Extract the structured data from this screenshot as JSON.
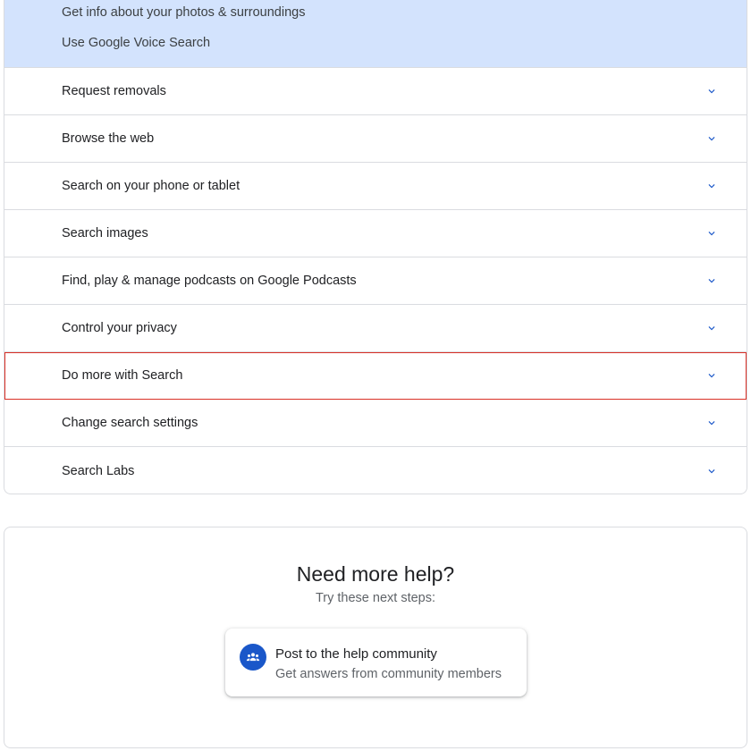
{
  "expanded_section": {
    "links": [
      "Get info about your photos & surroundings",
      "Use Google Voice Search"
    ]
  },
  "topics": [
    {
      "label": "Request removals"
    },
    {
      "label": "Browse the web"
    },
    {
      "label": "Search on your phone or tablet"
    },
    {
      "label": "Search images"
    },
    {
      "label": "Find, play & manage podcasts on Google Podcasts"
    },
    {
      "label": "Control your privacy"
    },
    {
      "label": "Do more with Search"
    },
    {
      "label": "Change search settings"
    },
    {
      "label": "Search Labs"
    }
  ],
  "help": {
    "title": "Need more help?",
    "subtitle": "Try these next steps:",
    "community": {
      "title": "Post to the help community",
      "description": "Get answers from community members",
      "icon": "community-icon"
    }
  },
  "colors": {
    "expanded_bg": "#d3e3fd",
    "chevron": "#1a57c9",
    "highlight_outline": "#d93025",
    "community_icon_bg": "#1a57c9"
  }
}
